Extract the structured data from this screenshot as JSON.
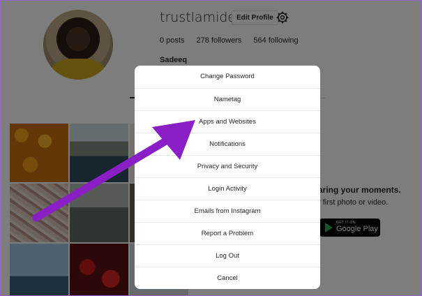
{
  "profile": {
    "username": "trustlamide",
    "edit_profile_label": "Edit Profile",
    "posts": "0 posts",
    "followers": "278 followers",
    "following": "564 following",
    "full_name": "Sadeeq"
  },
  "empty_state": {
    "title": "aring your moments.",
    "subtitle": "r first photo or video.",
    "store_badge_small": "GET IT ON",
    "store_badge_big": "Google Play"
  },
  "menu": {
    "items": [
      {
        "label": "Change Password"
      },
      {
        "label": "Nametag"
      },
      {
        "label": "Apps and Websites"
      },
      {
        "label": "Notifications"
      },
      {
        "label": "Privacy and Security"
      },
      {
        "label": "Login Activity"
      },
      {
        "label": "Emails from Instagram"
      },
      {
        "label": "Report a Problem"
      },
      {
        "label": "Log Out"
      },
      {
        "label": "Cancel"
      }
    ]
  },
  "annotation": {
    "arrow_color": "#8a1fc6",
    "points_to": "Apps and Websites"
  },
  "colors": {
    "overlay": "rgba(0,0,0,0.5)",
    "frame": "#9b62c7"
  }
}
